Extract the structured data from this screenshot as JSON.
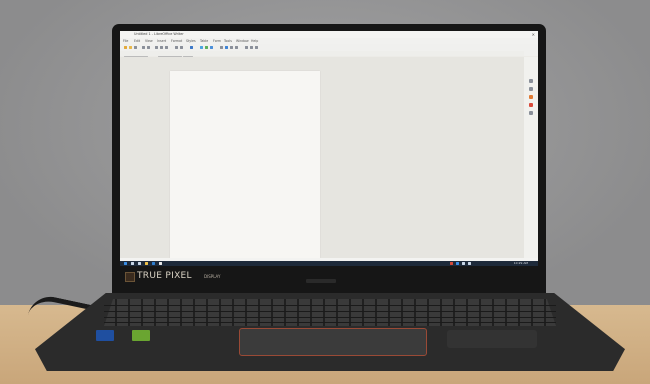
{
  "laptop_bezel": {
    "badge_title": "TRUE PIXEL",
    "badge_subtitle": "DISPLAY"
  },
  "screen": {
    "app": {
      "title": "Untitled 1 - LibreOffice Writer",
      "menus": [
        "File",
        "Edit",
        "View",
        "Insert",
        "Format",
        "Styles",
        "Table",
        "Form",
        "Tools",
        "Window",
        "Help"
      ]
    },
    "taskbar": {
      "clock": "10:29 AM"
    }
  },
  "colors": {
    "accent": "#9a4a36",
    "taskbar": "#1e2a3a"
  }
}
